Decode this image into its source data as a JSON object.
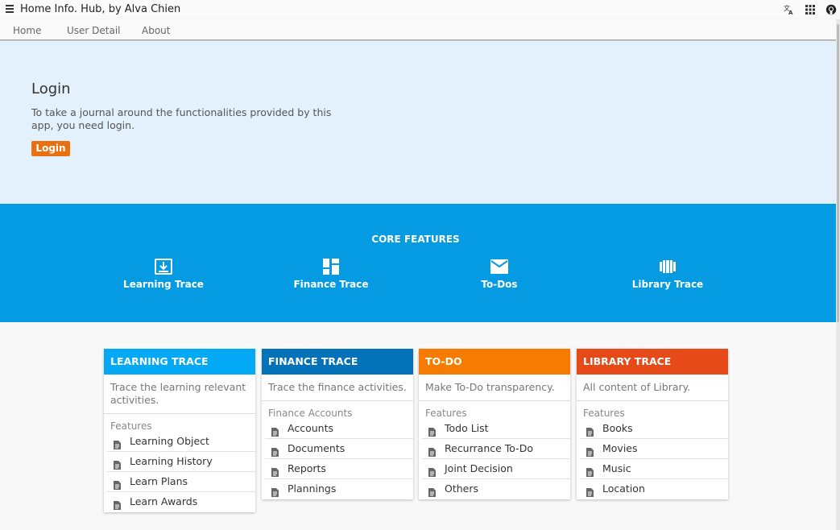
{
  "app": {
    "title": "Home Info. Hub, by Alva Chien"
  },
  "top_icons": [
    "translate-icon",
    "apps-grid-icon",
    "github-icon"
  ],
  "tabs": [
    {
      "label": "Home"
    },
    {
      "label": "User Detail"
    },
    {
      "label": "About"
    }
  ],
  "hero": {
    "title": "Login",
    "text": "To take a journal around the functionalities provided by this app, you need login.",
    "button": "Login"
  },
  "core": {
    "title": "CORE FEATURES",
    "features": [
      {
        "label": "Learning Trace",
        "icon": "download-box-icon"
      },
      {
        "label": "Finance Trace",
        "icon": "dashboard-icon"
      },
      {
        "label": "To-Dos",
        "icon": "mail-icon"
      },
      {
        "label": "Library Trace",
        "icon": "library-columns-icon"
      }
    ]
  },
  "colors": {
    "hero_bg": "#e3f1fc",
    "core_bg": "#059be3",
    "login_button": "#e8700f",
    "learning": "#03a9f4",
    "finance": "#0472b9",
    "todo": "#f57c00",
    "library": "#e64a19"
  },
  "cards": [
    {
      "title": "LEARNING TRACE",
      "description": "Trace the learning relevant activities.",
      "subheader": "Features",
      "items": [
        "Learning Object",
        "Learning History",
        "Learn Plans",
        "Learn Awards"
      ]
    },
    {
      "title": "FINANCE TRACE",
      "description": "Trace the finance activities.",
      "subheader": "Finance Accounts",
      "items": [
        "Accounts",
        "Documents",
        "Reports",
        "Plannings"
      ]
    },
    {
      "title": "TO-DO",
      "description": "Make To-Do transparency.",
      "subheader": "Features",
      "items": [
        "Todo List",
        "Recurrance To-Do",
        "Joint Decision",
        "Others"
      ]
    },
    {
      "title": "LIBRARY TRACE",
      "description": "All content of Library.",
      "subheader": "Features",
      "items": [
        "Books",
        "Movies",
        "Music",
        "Location"
      ]
    }
  ]
}
